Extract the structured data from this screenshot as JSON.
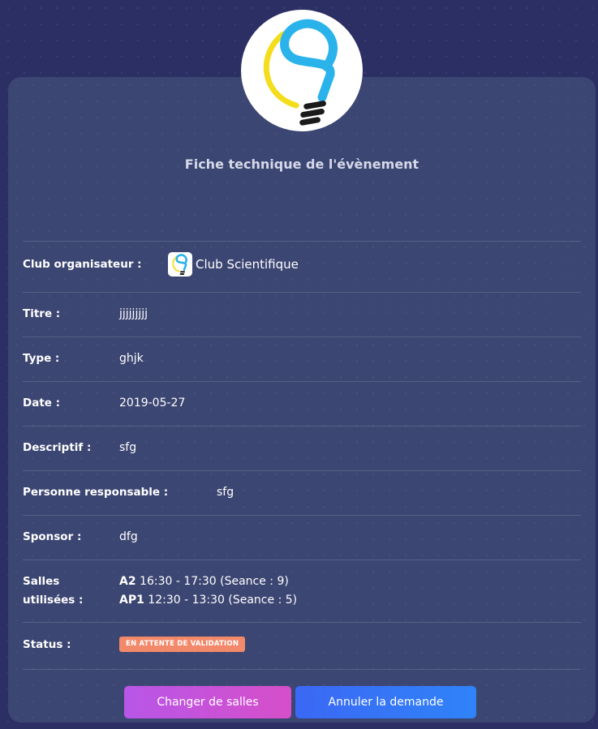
{
  "header": {
    "title": "Fiche technique de l'évènement"
  },
  "fields": {
    "club": {
      "label": "Club organisateur :",
      "value": "Club Scientifique"
    },
    "titre": {
      "label": "Titre :",
      "value": "jjjjjjjjj"
    },
    "type": {
      "label": "Type :",
      "value": "ghjk"
    },
    "date": {
      "label": "Date :",
      "value": "2019-05-27"
    },
    "descriptif": {
      "label": "Descriptif :",
      "value": "sfg"
    },
    "responsable": {
      "label": "Personne responsable :",
      "value": "sfg"
    },
    "sponsor": {
      "label": "Sponsor :",
      "value": "dfg"
    },
    "salles": {
      "label_line1": "Salles",
      "label_line2": "utilisées :",
      "items": [
        {
          "room": "A2",
          "detail": "16:30 - 17:30 (Seance : 9)"
        },
        {
          "room": "AP1",
          "detail": "12:30 - 13:30 (Seance : 5)"
        }
      ]
    },
    "status": {
      "label": "Status :",
      "badge": "EN ATTENTE DE VALIDATION",
      "badge_color": "#f3896b"
    }
  },
  "actions": {
    "change_rooms": "Changer de salles",
    "cancel_request": "Annuler la demande"
  },
  "colors": {
    "background": "#2b2f63",
    "card": "#3c4672",
    "button_purple": "#c552de",
    "button_blue": "#3575f6"
  },
  "icons": {
    "logo": "lightbulb-logo-icon"
  }
}
